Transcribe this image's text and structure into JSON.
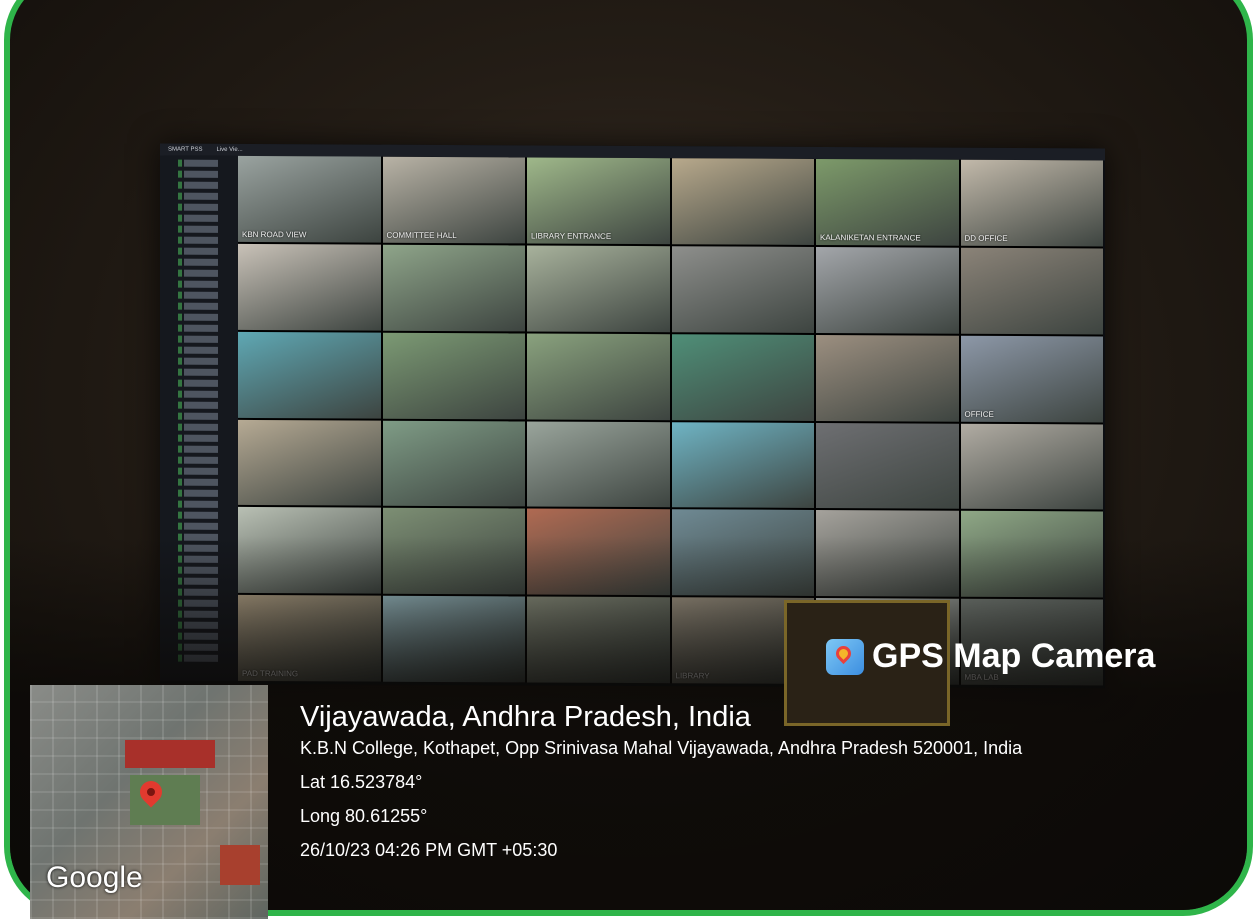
{
  "vms": {
    "app_name": "SMART PSS",
    "tab": "Live Vie...",
    "cameras": [
      {
        "label": "KBN ROAD VIEW",
        "color": "#9aa3a0"
      },
      {
        "label": "COMMITTEE HALL",
        "color": "#b9b3a6"
      },
      {
        "label": "LIBRARY ENTRANCE",
        "color": "#9fb88a"
      },
      {
        "label": "",
        "color": "#b8a98c"
      },
      {
        "label": "KALANIKETAN ENTRANCE",
        "color": "#7d9a6a"
      },
      {
        "label": "DD OFFICE",
        "color": "#c2b9aa"
      },
      {
        "label": "",
        "color": "#c9c2b8"
      },
      {
        "label": "",
        "color": "#8fa58a"
      },
      {
        "label": "",
        "color": "#a8b29c"
      },
      {
        "label": "",
        "color": "#8e8f8c"
      },
      {
        "label": "",
        "color": "#a3a6aa"
      },
      {
        "label": "",
        "color": "#8b8378"
      },
      {
        "label": "",
        "color": "#5fa8b4"
      },
      {
        "label": "",
        "color": "#7c9a74"
      },
      {
        "label": "",
        "color": "#8aa27e"
      },
      {
        "label": "",
        "color": "#4f8f78"
      },
      {
        "label": "",
        "color": "#9c8f80"
      },
      {
        "label": "OFFICE",
        "color": "#8d98a8"
      },
      {
        "label": "",
        "color": "#b6aa94"
      },
      {
        "label": "",
        "color": "#7f9c86"
      },
      {
        "label": "",
        "color": "#9aa59c"
      },
      {
        "label": "",
        "color": "#6fb4c4"
      },
      {
        "label": "",
        "color": "#6e6f72"
      },
      {
        "label": "",
        "color": "#b1aca3"
      },
      {
        "label": "",
        "color": "#b9c0b4"
      },
      {
        "label": "",
        "color": "#7d8f74"
      },
      {
        "label": "",
        "color": "#b06a52"
      },
      {
        "label": "",
        "color": "#6f8a94"
      },
      {
        "label": "",
        "color": "#a5a29c"
      },
      {
        "label": "",
        "color": "#8fa886"
      },
      {
        "label": "PAD TRAINING",
        "color": "#b7a68a"
      },
      {
        "label": "",
        "color": "#9dc0c8"
      },
      {
        "label": "",
        "color": "#8f9482"
      },
      {
        "label": "LIBRARY",
        "color": "#a79c8a"
      },
      {
        "label": "",
        "color": "#c8ccc8"
      },
      {
        "label": "MBA LAB",
        "color": "#7e8680"
      }
    ]
  },
  "overlay": {
    "brand": "GPS Map Camera",
    "google": "Google",
    "city": "Vijayawada, Andhra Pradesh, India",
    "address": "K.B.N College, Kothapet, Opp Srinivasa Mahal Vijayawada, Andhra Pradesh 520001, India",
    "lat": "Lat 16.523784°",
    "long": "Long 80.61255°",
    "datetime": "26/10/23 04:26 PM GMT +05:30"
  }
}
